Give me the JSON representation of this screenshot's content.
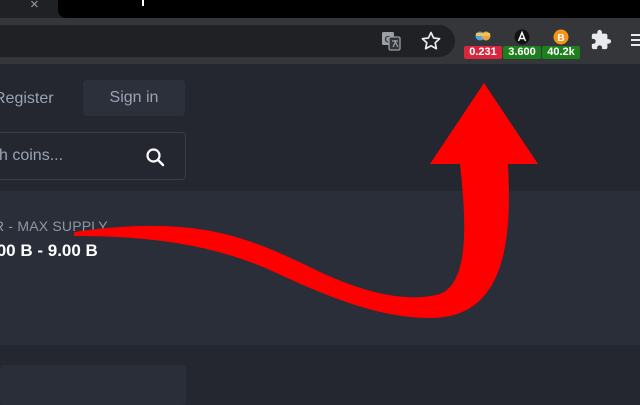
{
  "browser": {
    "tab_close_glyph": "×",
    "extensions": [
      {
        "name": "ext-1",
        "badge": "0.231",
        "badge_color": "#d7263d"
      },
      {
        "name": "ext-2",
        "badge": "3.600",
        "badge_color": "#1e7f1e"
      },
      {
        "name": "ext-3",
        "badge": "40.2k",
        "badge_color": "#1e7f1e"
      }
    ],
    "icons": [
      "translate-icon",
      "bookmark-star-icon",
      "extensions-puzzle-icon",
      "menu-icon"
    ]
  },
  "header": {
    "register_label": "Register",
    "signin_label": "Sign in"
  },
  "search": {
    "placeholder": "h coins..."
  },
  "supply": {
    "label": "R - MAX SUPPLY",
    "value": ".00 B - 9.00 B"
  },
  "colors": {
    "background": "#242730",
    "panel": "#2a2e38",
    "annotation_arrow": "#ff0000"
  }
}
